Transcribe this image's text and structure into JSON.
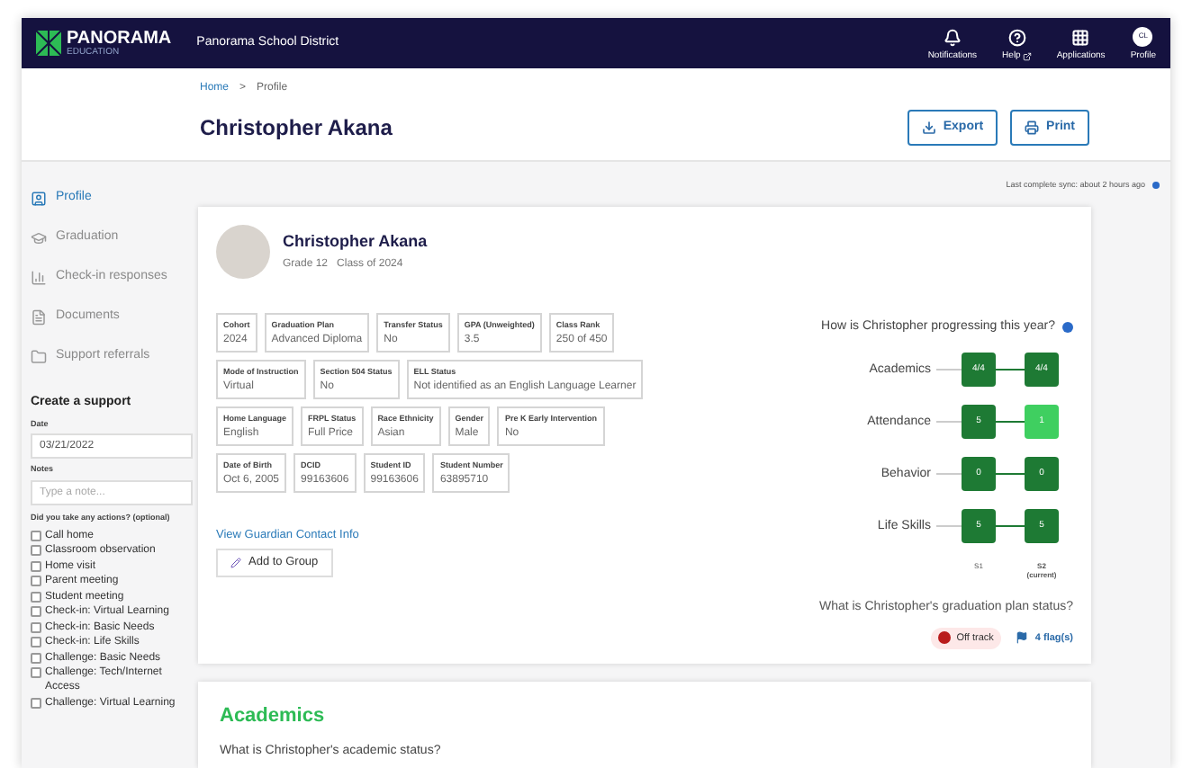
{
  "nav": {
    "logo": "PANORAMA",
    "logo_sub": "EDUCATION",
    "district": "Panorama School District",
    "items": [
      {
        "kind": "bell",
        "label": "Notifications"
      },
      {
        "kind": "help",
        "label": "Help"
      },
      {
        "kind": "grid",
        "label": "Applications"
      },
      {
        "kind": "avatar",
        "label": "Profile",
        "initials": "CL"
      }
    ]
  },
  "header": {
    "breadcrumb": [
      "Home",
      "Profile"
    ],
    "separator": ">",
    "title": "Christopher Akana",
    "buttons": [
      {
        "kind": "export",
        "label": "Export"
      },
      {
        "kind": "print",
        "label": "Print"
      }
    ]
  },
  "sidebar": {
    "items": [
      {
        "kind": "profile",
        "label": "Profile",
        "selected": true
      },
      {
        "kind": "graduation",
        "label": "Graduation",
        "selected": false
      },
      {
        "kind": "checkin",
        "label": "Check-in responses",
        "selected": false
      },
      {
        "kind": "documents",
        "label": "Documents",
        "selected": false
      },
      {
        "kind": "referrals",
        "label": "Support referrals",
        "selected": false
      }
    ],
    "form": {
      "title": "Create a support",
      "date_label": "Date",
      "date_value": "03/21/2022",
      "notes_label": "Notes",
      "notes_placeholder": "Type a note...",
      "actions_label": "Did you take any actions? (optional)",
      "actions": [
        {
          "label": "Call home",
          "checked": false
        },
        {
          "label": "Classroom observation",
          "checked": false
        },
        {
          "label": "Home visit",
          "checked": false
        },
        {
          "label": "Parent meeting",
          "checked": false
        },
        {
          "label": "Student meeting",
          "checked": false
        },
        {
          "label": "Check-in: Virtual Learning",
          "checked": false
        },
        {
          "label": "Check-in: Basic Needs",
          "checked": false
        },
        {
          "label": "Check-in: Life Skills",
          "checked": false
        },
        {
          "label": "Challenge: Basic Needs",
          "checked": false
        },
        {
          "label": "Challenge: Tech/Internet Access",
          "checked": false
        },
        {
          "label": "Challenge: Virtual Learning",
          "checked": false
        }
      ]
    }
  },
  "sync": "Last complete sync: about 2 hours ago",
  "student": {
    "name": "Christopher Akana",
    "grade": "Grade 12",
    "class": "Class of 2024",
    "fields": [
      [
        {
          "label": "Cohort",
          "value": "2024"
        },
        {
          "label": "Graduation Plan",
          "value": "Advanced Diploma"
        },
        {
          "label": "Transfer Status",
          "value": "No"
        },
        {
          "label": "GPA (Unweighted)",
          "value": "3.5"
        },
        {
          "label": "Class Rank",
          "value": "250 of 450"
        }
      ],
      [
        {
          "label": "Mode of Instruction",
          "value": "Virtual"
        },
        {
          "label": "Section 504 Status",
          "value": "No"
        },
        {
          "label": "ELL Status",
          "value": "Not identified as an English Language Learner"
        }
      ],
      [
        {
          "label": "Home Language",
          "value": "English"
        },
        {
          "label": "FRPL Status",
          "value": "Full Price"
        },
        {
          "label": "Race Ethnicity",
          "value": "Asian"
        },
        {
          "label": "Gender",
          "value": "Male"
        },
        {
          "label": "Pre K Early Intervention",
          "value": "No"
        }
      ],
      [
        {
          "label": "Date of Birth",
          "value": "Oct 6, 2005"
        },
        {
          "label": "DCID",
          "value": "99163606"
        },
        {
          "label": "Student ID",
          "value": "99163606"
        },
        {
          "label": "Student Number",
          "value": "63895710"
        }
      ]
    ],
    "guardian_link": "View Guardian Contact Info",
    "add_button": "Add to Group"
  },
  "progress": {
    "question": "How is Christopher progressing this year?",
    "rows": [
      {
        "label": "Academics",
        "s1": {
          "value": "4/4",
          "color": "#1e7a34"
        },
        "s2": {
          "value": "4/4",
          "color": "#1e7a34"
        }
      },
      {
        "label": "Attendance",
        "s1": {
          "value": "5",
          "color": "#1e7a34"
        },
        "s2": {
          "value": "1",
          "color": "#3fcf60"
        }
      },
      {
        "label": "Behavior",
        "s1": {
          "value": "0",
          "color": "#1e7a34"
        },
        "s2": {
          "value": "0",
          "color": "#1e7a34"
        }
      },
      {
        "label": "Life Skills",
        "s1": {
          "value": "5",
          "color": "#1e7a34"
        },
        "s2": {
          "value": "5",
          "color": "#1e7a34"
        }
      }
    ],
    "col_1": "S1",
    "col_2": "S2",
    "col_2_sub": "(current)"
  },
  "graduation": {
    "question": "What is Christopher's graduation plan status?",
    "status": "Off track",
    "flags": "4 flag(s)"
  },
  "academics": {
    "title": "Academics",
    "question": "What is Christopher's academic status?"
  }
}
